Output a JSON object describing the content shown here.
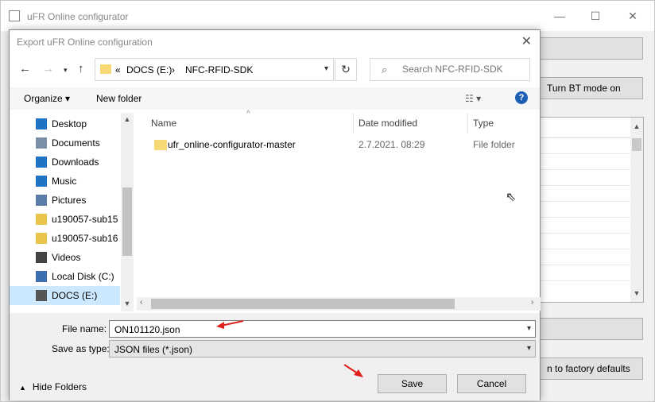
{
  "background_window": {
    "title": "uFR Online configurator",
    "minimize": "—",
    "maximize": "☐",
    "close": "✕",
    "bt_button": "Turn BT mode on",
    "reset_button": "n to factory defaults"
  },
  "dialog": {
    "title": "Export uFR Online configuration",
    "close": "✕",
    "address": {
      "prefix": "«",
      "segments": [
        "DOCS (E:)",
        "›",
        "NFC-RFID-SDK"
      ]
    },
    "search_placeholder": "Search NFC-RFID-SDK",
    "toolbar": {
      "organize": "Organize ▾",
      "new_folder": "New folder",
      "view": "☷ ▾",
      "help": "?"
    },
    "nav_items": [
      {
        "label": "Desktop",
        "icon": "desktop-icon",
        "color": "#1e73c7"
      },
      {
        "label": "Documents",
        "icon": "documents-icon",
        "color": "#7a8fa6"
      },
      {
        "label": "Downloads",
        "icon": "downloads-icon",
        "color": "#1e73c7"
      },
      {
        "label": "Music",
        "icon": "music-icon",
        "color": "#1e73c7"
      },
      {
        "label": "Pictures",
        "icon": "pictures-icon",
        "color": "#5b7ea8"
      },
      {
        "label": "u190057-sub15 (",
        "icon": "usb-drive-icon",
        "color": "#e8c44a"
      },
      {
        "label": "u190057-sub16 (",
        "icon": "usb-drive-icon",
        "color": "#e8c44a"
      },
      {
        "label": "Videos",
        "icon": "videos-icon",
        "color": "#444444"
      },
      {
        "label": "Local Disk (C:)",
        "icon": "disk-icon",
        "color": "#3d6fb0"
      },
      {
        "label": "DOCS (E:)",
        "icon": "disk-icon",
        "color": "#555555",
        "selected": true
      }
    ],
    "columns": {
      "name": "Name",
      "date": "Date modified",
      "type": "Type"
    },
    "files": [
      {
        "name": "ufr_online-configurator-master",
        "date": "2.7.2021. 08:29",
        "type": "File folder"
      }
    ],
    "file_name_label": "File name:",
    "file_name_value": "ON101120.json",
    "save_type_label": "Save as type:",
    "save_type_value": "JSON files (*.json)",
    "hide_folders": "Hide Folders",
    "save_button": "Save",
    "cancel_button": "Cancel"
  },
  "colors": {
    "accent": "#1c5fb4",
    "selection": "#cce8ff",
    "annotation": "#e0201b"
  }
}
